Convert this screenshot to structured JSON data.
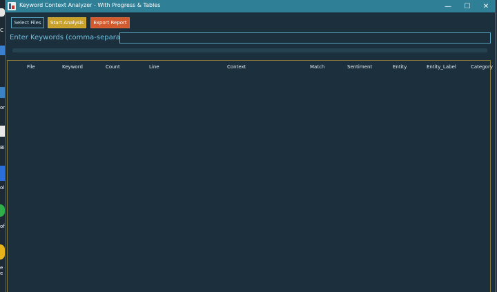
{
  "window": {
    "title": "Keyword Context Analyzer - With Progress & Tables"
  },
  "window_controls": {
    "minimize": "—",
    "maximize": "☐",
    "close": "✕"
  },
  "toolbar": {
    "select_files_label": "Select Files",
    "start_analysis_label": "Start Analysis",
    "export_report_label": "Export Report"
  },
  "keywords": {
    "label": "Enter Keywords (comma-separated)",
    "value": ""
  },
  "progress": {
    "value": 0
  },
  "table": {
    "columns": [
      "File",
      "Keyword",
      "Count",
      "Line",
      "Context",
      "Match",
      "Sentiment",
      "Entity",
      "Entity_Label",
      "Category"
    ],
    "rows": []
  },
  "desktop_fragments": [
    "C",
    "ork",
    "Bi",
    "ol",
    "of",
    "e",
    "e"
  ],
  "colors": {
    "titlebar": "#2f7f96",
    "window_bg": "#1b2f3d",
    "accent_input": "#5aa9c4",
    "start_button": "#c8a02a",
    "export_button": "#d15a2e",
    "label": "#6fc2e0"
  }
}
